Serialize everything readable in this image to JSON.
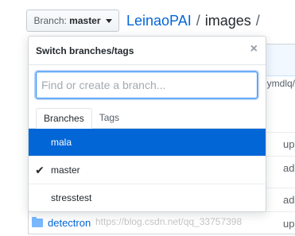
{
  "header": {
    "branch_label": "Branch:",
    "branch_name": "master",
    "repo": "LeinaoPAI",
    "separator": "/",
    "path": "images",
    "trailing_separator": "/"
  },
  "dropdown": {
    "title": "Switch branches/tags",
    "close_glyph": "×",
    "filter_placeholder": "Find or create a branch...",
    "filter_value": "",
    "tabs": [
      {
        "label": "Branches",
        "selected": true
      },
      {
        "label": "Tags",
        "selected": false
      }
    ],
    "branches": [
      {
        "name": "mala",
        "checked": false,
        "highlighted": true
      },
      {
        "name": "master",
        "checked": true,
        "highlighted": false
      },
      {
        "name": "stresstest",
        "checked": false,
        "highlighted": false
      }
    ],
    "check_glyph": "✔"
  },
  "background_table": {
    "header_fragment": "ymdlq/",
    "row_fragments": [
      "up",
      "ad",
      "ad",
      "up"
    ],
    "visible_folder": "detectron"
  },
  "watermark": "https://blog.csdn.net/qq_33757398",
  "colors": {
    "accent": "#0366d6",
    "link": "#0366d6",
    "border": "#d1d5da"
  }
}
